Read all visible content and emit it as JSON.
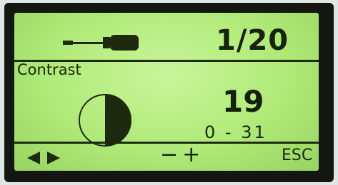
{
  "header": {
    "tool_icon": "screwdriver-icon",
    "page": "1/20"
  },
  "setting": {
    "label": "Contrast",
    "icon": "half-circle-contrast-icon",
    "value": "19",
    "range": "0 - 31"
  },
  "softkeys": {
    "navigate_icon": "left-right-arrows-icon",
    "adjust_label": "−+",
    "esc_label": "ESC"
  },
  "colors": {
    "lcd_background": "#b0ea78",
    "lcd_ink": "#17230d",
    "bezel": "#141711"
  }
}
